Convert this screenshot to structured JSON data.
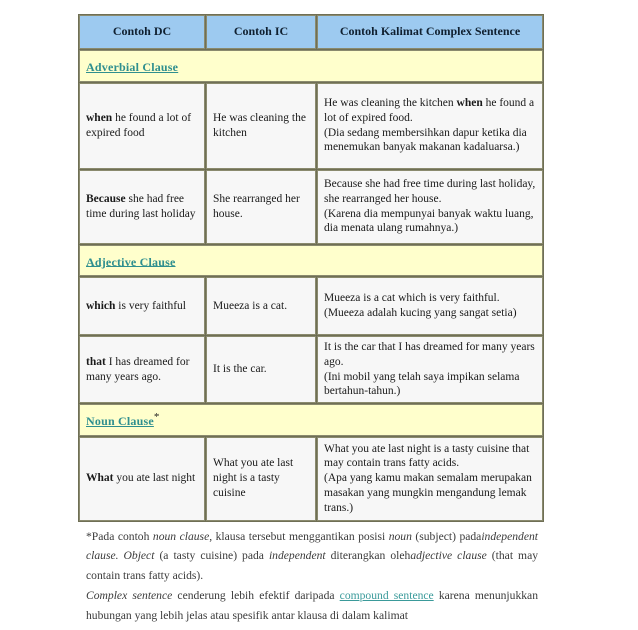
{
  "table": {
    "headers": [
      {
        "label": "Contoh DC"
      },
      {
        "label": "Contoh IC"
      },
      {
        "label": "Contoh Kalimat Complex Sentence"
      }
    ],
    "sections": [
      {
        "title": "Adverbial Clause",
        "star": "",
        "rows": [
          {
            "dc_bold": "when",
            "dc_rest": " he found a lot of expired food",
            "ic": "He was cleaning the kitchen",
            "cs_en_pre": "He was cleaning the kitchen ",
            "cs_en_bold": "when",
            "cs_en_post": " he found a lot of expired food.",
            "cs_id": "(Dia sedang membersihkan dapur ketika dia menemukan banyak makanan kadaluarsa.)"
          },
          {
            "dc_bold": "Because",
            "dc_rest": " she had free time during last holiday",
            "ic": "She rearranged her house.",
            "cs_en_pre": "Because she had free time during last holiday, she rearranged her house.",
            "cs_en_bold": "",
            "cs_en_post": "",
            "cs_id": "(Karena dia mempunyai banyak waktu luang, dia menata ulang rumahnya.)"
          }
        ]
      },
      {
        "title": "Adjective Clause",
        "star": "",
        "rows": [
          {
            "dc_bold": "which",
            "dc_rest": " is very faithful",
            "ic": "Mueeza is a cat.",
            "cs_en_pre": "Mueeza is a cat which is very faithful.",
            "cs_en_bold": "",
            "cs_en_post": "",
            "cs_id": "(Mueeza adalah kucing yang sangat setia)"
          },
          {
            "dc_bold": "that",
            "dc_rest": " I has dreamed for many years ago.",
            "ic": "It is the car.",
            "cs_en_pre": "It is the car that I has dreamed for many years ago.",
            "cs_en_bold": "",
            "cs_en_post": "",
            "cs_id": "(Ini mobil yang telah saya impikan selama bertahun-tahun.)"
          }
        ]
      },
      {
        "title": "Noun Clause",
        "star": "*",
        "rows": [
          {
            "dc_bold": "What",
            "dc_rest": " you ate last night",
            "ic": "What you ate last night is a tasty cuisine",
            "cs_en_pre": "What you ate last night is a tasty cuisine that may contain trans fatty acids.",
            "cs_en_bold": "",
            "cs_en_post": "",
            "cs_id": "(Apa yang kamu makan semalam merupakan masakan yang mungkin mengandung lemak trans.)"
          }
        ]
      }
    ]
  },
  "notes": {
    "p1_a": "*Pada contoh ",
    "p1_i1": "noun clause",
    "p1_b": ", klausa tersebut menggantikan posisi ",
    "p1_i2": "noun",
    "p1_c": " (subject) pada",
    "p1_i3": "independent clause. Object",
    "p1_d": " (a tasty cuisine)  pada ",
    "p1_i4": "independent",
    "p1_e": " diterangkan oleh",
    "p1_i5": "adjective clause",
    "p1_f": " (that may contain trans fatty acids).",
    "p2_i1": "Complex sentence",
    "p2_a": " cenderung lebih efektif daripada ",
    "p2_link": "compound sentence",
    "p2_b": " karena menunjukkan hubungan yang lebih jelas atau spesifik antar klausa di dalam kalimat"
  },
  "colors": {
    "header_blue": "#9dcaf0",
    "section_yellow": "#ffffcc",
    "link_teal": "#2f8f8f",
    "cell_bg": "#f7f7f7",
    "border": "#8a8a6e"
  }
}
